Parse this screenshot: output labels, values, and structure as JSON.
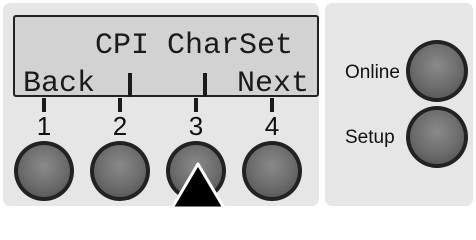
{
  "lcd": {
    "line1": "CPI CharSet",
    "back_label": "Back",
    "next_label": "Next"
  },
  "keys": [
    {
      "number": "1"
    },
    {
      "number": "2"
    },
    {
      "number": "3"
    },
    {
      "number": "4"
    }
  ],
  "side_buttons": {
    "online_label": "Online",
    "setup_label": "Setup"
  },
  "pointer": {
    "target_key": "3",
    "icon": "up-arrow-icon"
  },
  "colors": {
    "panel": "#e6e6e6",
    "display": "#d2d2d2",
    "key": "#6b6b6b"
  }
}
